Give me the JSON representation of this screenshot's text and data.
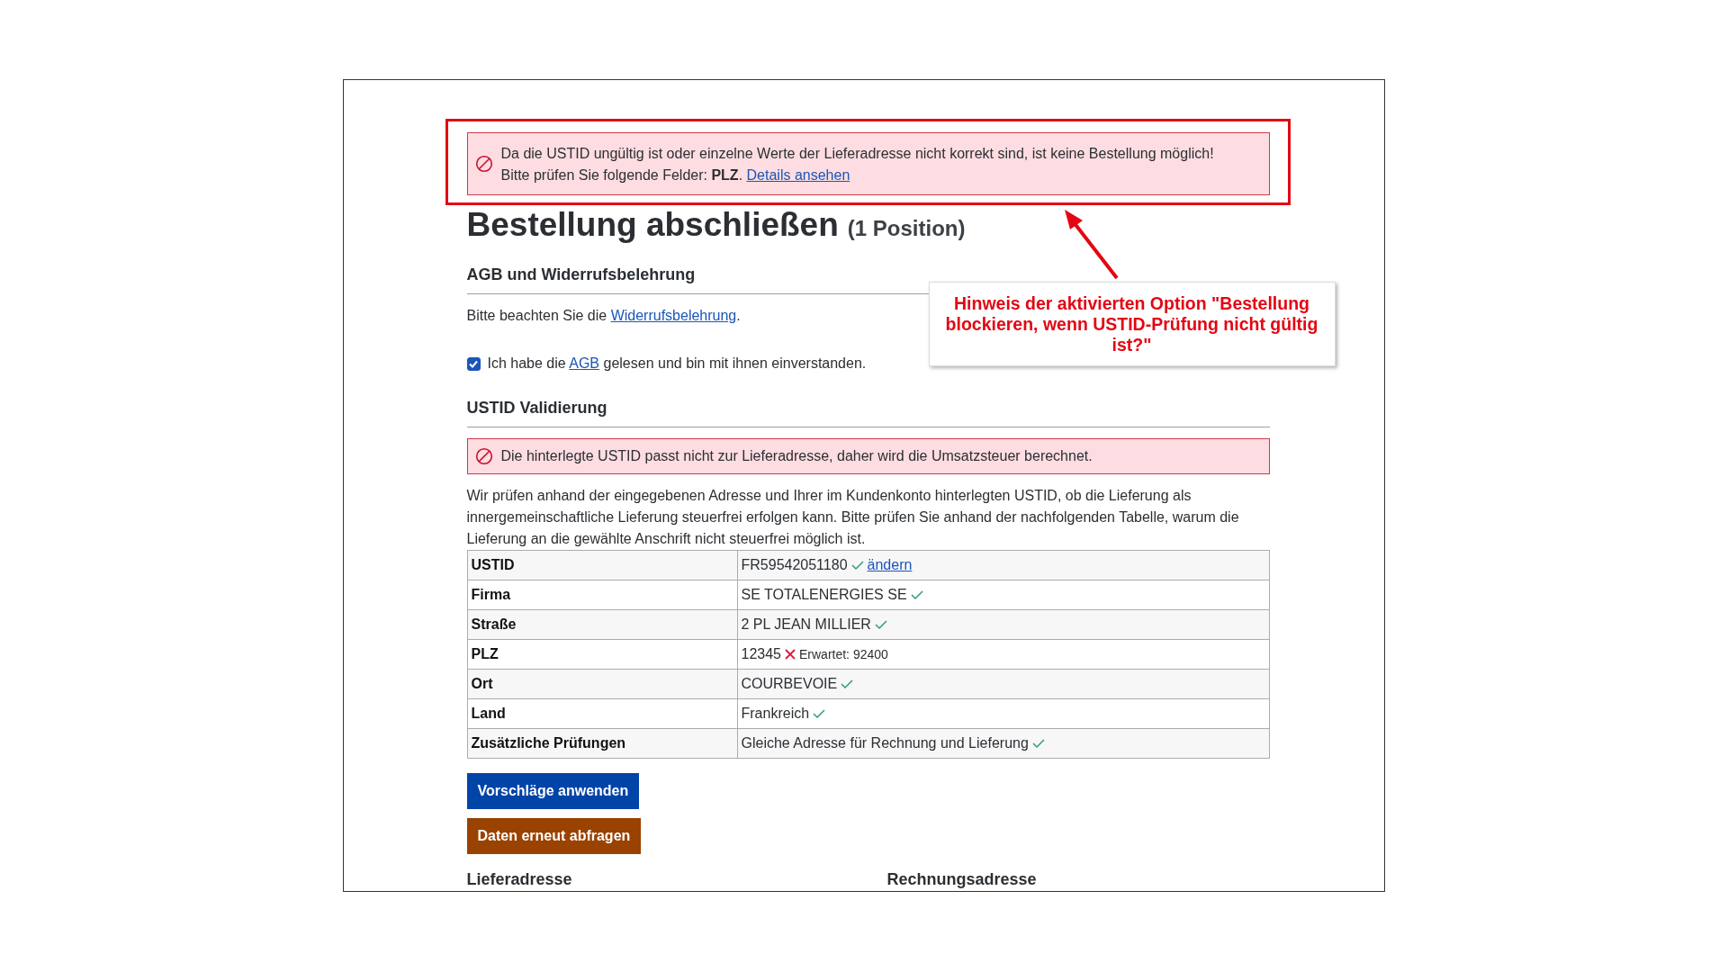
{
  "alert": {
    "line1": "Da die USTID ungültig ist oder einzelne Werte der Lieferadresse nicht korrekt sind, ist keine Bestellung möglich!",
    "line2": "Bitte prüfen Sie folgende Felder: **PLZ**.",
    "link": "Details ansehen"
  },
  "heading": {
    "title": "Bestellung abschließen",
    "count": "(1 Position)"
  },
  "terms": {
    "title": "AGB und Widerrufsbelehrung",
    "notice_text": "Bitte beachten Sie die",
    "notice_link": "Widerrufsbelehrung",
    "notice_end": ".",
    "consent": {
      "checked": true,
      "before": "Ich habe die",
      "link": "AGB",
      "after": "gelesen und bin mit ihnen einverstanden."
    }
  },
  "validation": {
    "title": "USTID Validierung",
    "alert": "Die hinterlegte USTID passt nicht zur Lieferadresse, daher wird die Umsatzsteuer berechnet.",
    "description": "Wir prüfen anhand der eingegebenen Adresse und Ihrer im Kundenkonto hinterlegten USTID, ob die Lieferung als innergemeinschaftliche Lieferung steuerfrei erfolgen kann. Bitte prüfen Sie anhand der nachfolgenden Tabelle, warum die Lieferung an die gewählte Anschrift nicht steuerfrei möglich ist.",
    "rows": [
      {
        "label": "USTID",
        "value": "FR59542051180",
        "valid": true,
        "link": "ändern"
      },
      {
        "label": "Firma",
        "value": "SE TOTALENERGIES SE",
        "valid": true
      },
      {
        "label": "Straße",
        "value": "2 PL JEAN MILLIER",
        "valid": true
      },
      {
        "label": "PLZ",
        "value": "12345",
        "valid": false,
        "note": "Erwartet: 92400"
      },
      {
        "label": "Ort",
        "value": "COURBEVOIE",
        "valid": true
      },
      {
        "label": "Land",
        "value": "Frankreich",
        "valid": true
      },
      {
        "label": "Zusätzliche Prüfungen",
        "value": "Gleiche Adresse für Rechnung und Lieferung",
        "valid": true
      }
    ]
  },
  "buttons": [
    {
      "label": "Vorschläge anwenden",
      "kind": "primary"
    },
    {
      "label": "Daten erneut abfragen",
      "kind": "warning"
    }
  ],
  "address_headings": [
    "Lieferadresse",
    "Rechnungsadresse"
  ],
  "annotation": {
    "text": "Hinweis der aktivierten Option \"Bestellung blockieren, wenn USTID-Prüfung nicht gültig ist?\""
  }
}
